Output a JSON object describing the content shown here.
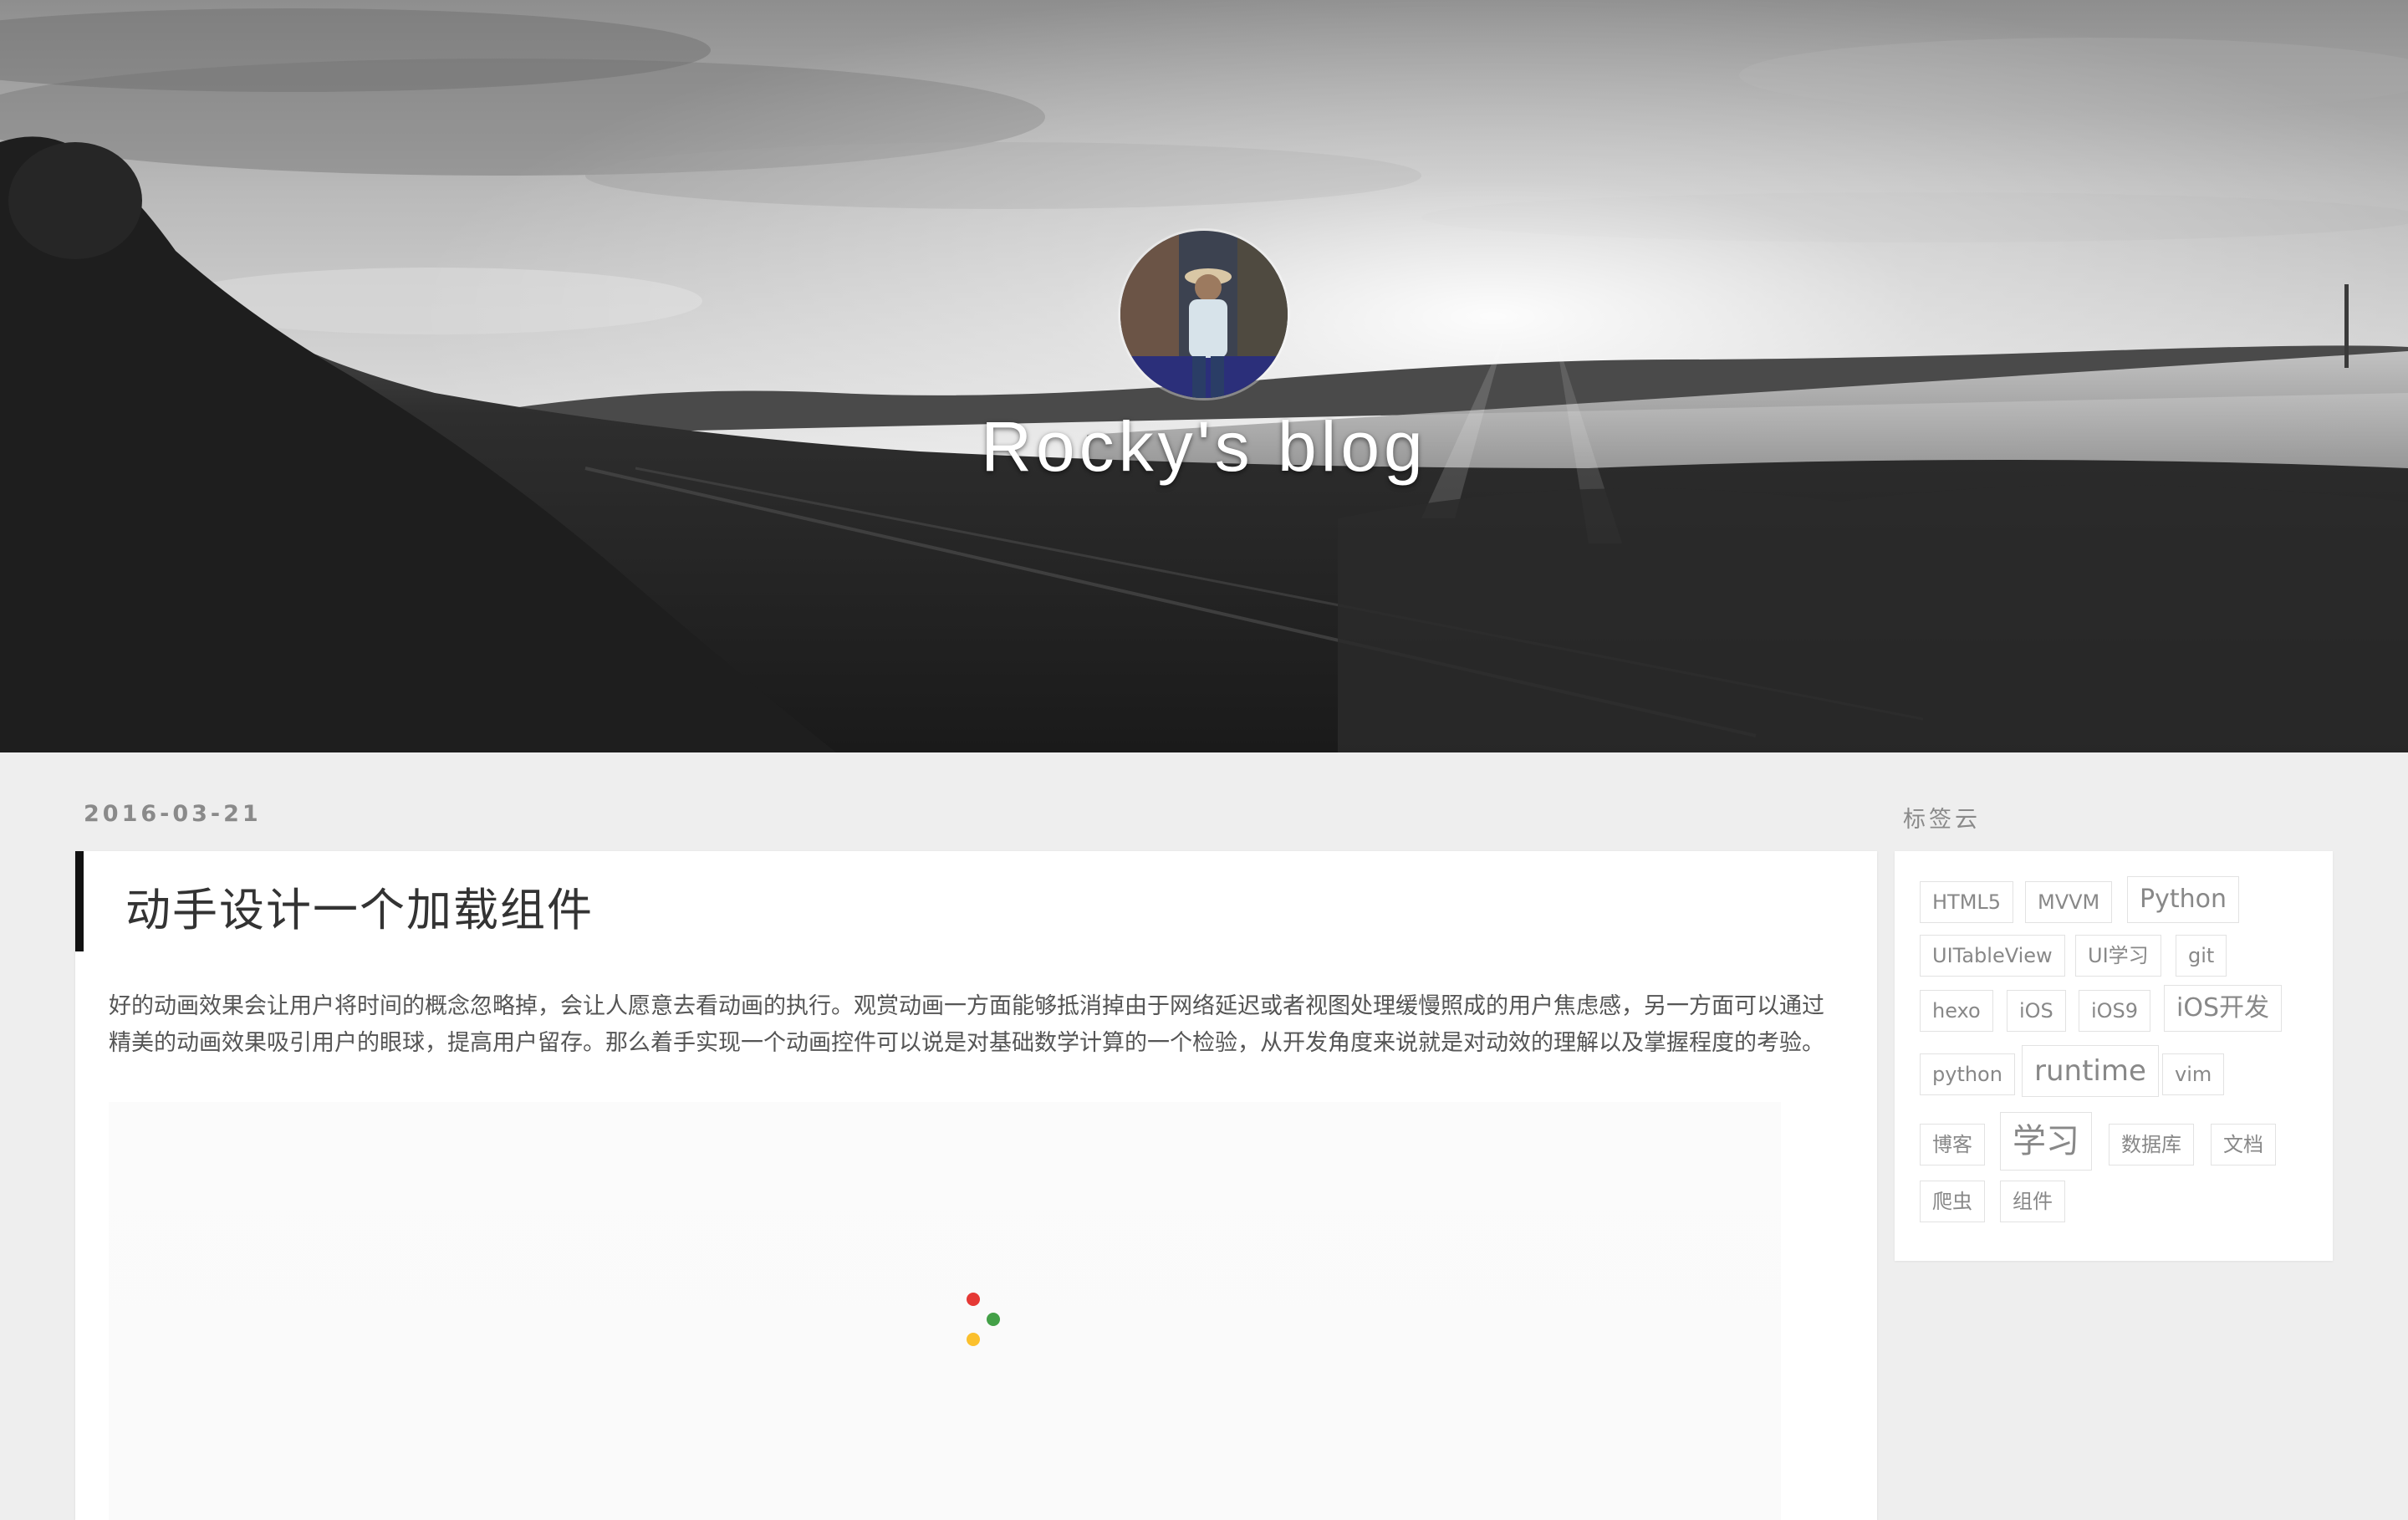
{
  "header": {
    "site_title": "Rocky's blog"
  },
  "post": {
    "date": "2016-03-21",
    "title": "动手设计一个加载组件",
    "excerpt": "好的动画效果会让用户将时间的概念忽略掉，会让人愿意去看动画的执行。观赏动画一方面能够抵消掉由于网络延迟或者视图处理缓慢照成的用户焦虑感，另一方面可以通过精美的动画效果吸引用户的眼球，提高用户留存。那么着手实现一个动画控件可以说是对基础数学计算的一个检验，从开发角度来说就是对动效的理解以及掌握程度的考验。",
    "loader_colors": [
      "#e53935",
      "#43a047",
      "#fbc02d"
    ]
  },
  "sidebar": {
    "heading": "标签云",
    "tags": [
      "HTML5",
      "MVVM",
      "Python",
      "UITableView",
      "UI学习",
      "git",
      "hexo",
      "iOS",
      "iOS9",
      "iOS开发",
      "python",
      "runtime",
      "vim",
      "博客",
      "学习",
      "数据库",
      "文档",
      "爬虫",
      "组件"
    ]
  }
}
